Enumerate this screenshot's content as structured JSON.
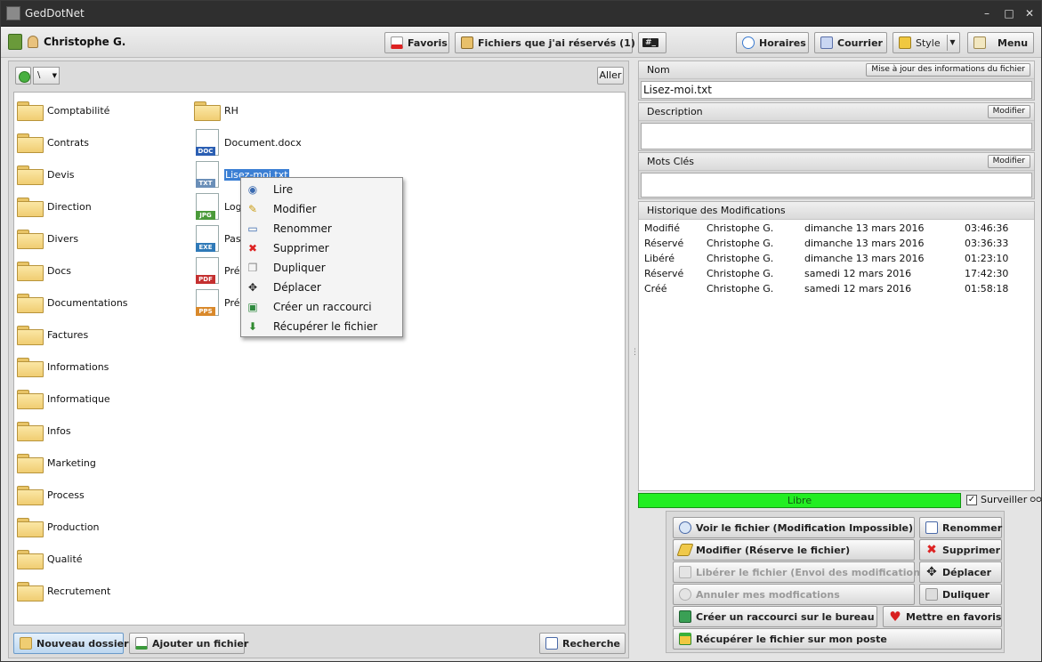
{
  "window": {
    "title": "GedDotNet"
  },
  "toolbar": {
    "user": "Christophe G.",
    "favoris": "Favoris",
    "reserved": "Fichiers que j'ai réservés (1)",
    "console": "#_",
    "horaires": "Horaires",
    "courrier": "Courrier",
    "style": "Style",
    "menu": "Menu"
  },
  "nav": {
    "path": "\\",
    "go_label": "Aller"
  },
  "folders": [
    "Comptabilité",
    "Contrats",
    "Devis",
    "Direction",
    "Divers",
    "Docs",
    "Documentations",
    "Factures",
    "Informations",
    "Informatique",
    "Infos",
    "Marketing",
    "Process",
    "Production",
    "Qualité",
    "Recrutement"
  ],
  "files": [
    {
      "name": "RH",
      "type": "folder"
    },
    {
      "name": "Document.docx",
      "type": "DOC",
      "color": "#2b5fb3"
    },
    {
      "name": "Lisez-moi.txt",
      "type": "TXT",
      "color": "#6b8fb8"
    },
    {
      "name": "Log",
      "type": "JPG",
      "color": "#4a9a3a"
    },
    {
      "name": "Pas",
      "type": "EXE",
      "color": "#2f7ab8"
    },
    {
      "name": "Prés",
      "type": "PDF",
      "color": "#c43030"
    },
    {
      "name": "Prés",
      "type": "PPS",
      "color": "#d9892b"
    }
  ],
  "context_menu": {
    "items": [
      {
        "label": "Lire",
        "icon": "eye-icon"
      },
      {
        "label": "Modifier",
        "icon": "pencil-icon"
      },
      {
        "label": "Renommer",
        "icon": "rename-icon"
      },
      {
        "label": "Supprimer",
        "icon": "delete-x-icon"
      },
      {
        "label": "Dupliquer",
        "icon": "duplicate-icon"
      },
      {
        "label": "Déplacer",
        "icon": "move-arrows-icon"
      },
      {
        "label": "Créer un raccourci",
        "icon": "shortcut-icon"
      },
      {
        "label": "Récupérer le fichier",
        "icon": "download-icon"
      }
    ]
  },
  "bottom": {
    "new_folder": "Nouveau dossier",
    "add_file": "Ajouter un fichier",
    "search": "Recherche"
  },
  "details": {
    "name_label": "Nom",
    "update_label": "Mise à jour des informations du fichier",
    "name_value": "Lisez-moi.txt",
    "desc_label": "Description",
    "desc_modify": "Modifier",
    "desc_value": "",
    "keywords_label": "Mots Clés",
    "keywords_modify": "Modifier",
    "keywords_value": "",
    "history_label": "Historique des Modifications",
    "history": [
      [
        "Modifié",
        "Christophe G.",
        "dimanche 13 mars 2016",
        "03:46:36"
      ],
      [
        "Réservé",
        "Christophe G.",
        "dimanche 13 mars 2016",
        "03:36:33"
      ],
      [
        "Libéré",
        "Christophe G.",
        "dimanche 13 mars 2016",
        "01:23:10"
      ],
      [
        "Réservé",
        "Christophe G.",
        "samedi 12 mars 2016",
        "17:42:30"
      ],
      [
        "Créé",
        "Christophe G.",
        "samedi 12 mars 2016",
        "01:58:18"
      ]
    ],
    "status": "Libre",
    "status_color": "#22ee22",
    "watch_label": "Surveiller"
  },
  "actions": {
    "view": "Voir le fichier (Modification Impossible)",
    "rename": "Renommer",
    "modify": "Modifier (Réserve le fichier)",
    "delete": "Supprimer",
    "release": "Libérer le fichier (Envoi des modifications)",
    "move": "Déplacer",
    "cancel": "Annuler mes modfications",
    "duplicate": "Duliquer",
    "shortcut": "Créer un raccourci sur le bureau",
    "favorite": "Mettre en favoris",
    "download": "Récupérer le fichier sur mon poste"
  }
}
